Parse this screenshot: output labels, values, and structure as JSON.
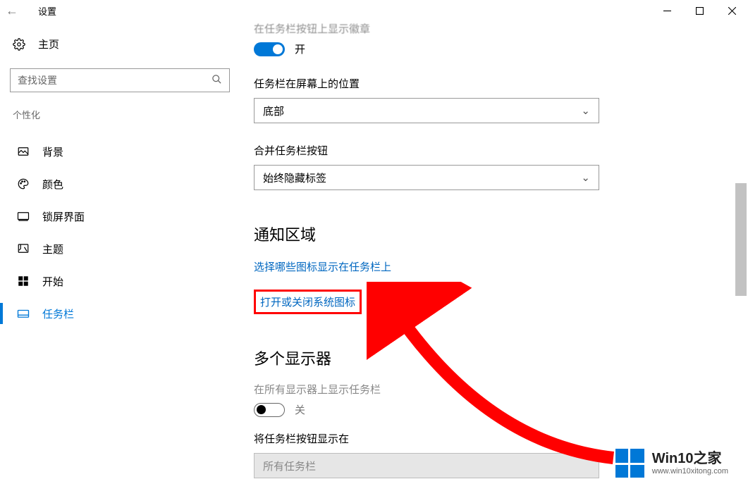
{
  "window": {
    "title": "设置"
  },
  "sidebar": {
    "home": "主页",
    "search_placeholder": "查找设置",
    "category": "个性化",
    "items": [
      {
        "label": "背景"
      },
      {
        "label": "颜色"
      },
      {
        "label": "锁屏界面"
      },
      {
        "label": "主题"
      },
      {
        "label": "开始"
      },
      {
        "label": "任务栏"
      }
    ]
  },
  "content": {
    "truncated_header": "在任务栏按钮上显示徽章",
    "toggle_on_label": "开",
    "field_position": "任务栏在屏幕上的位置",
    "combo_position_value": "底部",
    "field_combine": "合并任务栏按钮",
    "combo_combine_value": "始终隐藏标签",
    "section_notify": "通知区域",
    "link_select_icons": "选择哪些图标显示在任务栏上",
    "link_system_icons": "打开或关闭系统图标",
    "section_multi": "多个显示器",
    "field_all_displays": "在所有显示器上显示任务栏",
    "toggle_off_label": "关",
    "field_show_buttons": "将任务栏按钮显示在",
    "combo_show_buttons_value": "所有任务栏"
  },
  "branding": {
    "name": "Win10之家",
    "url": "www.win10xitong.com"
  }
}
